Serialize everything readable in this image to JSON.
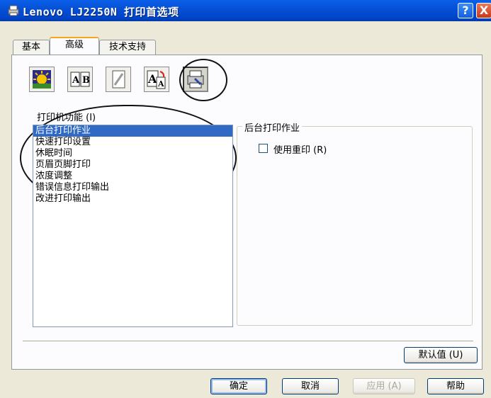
{
  "window": {
    "title": "Lenovo LJ2250N 打印首选项",
    "help_button": "?",
    "close_button": "X"
  },
  "tabs": [
    {
      "label": "基本"
    },
    {
      "label": "高级"
    },
    {
      "label": "技术支持"
    }
  ],
  "feature_buttons": [
    {
      "icon": "quality-icon"
    },
    {
      "icon": "duplex-icon"
    },
    {
      "icon": "watermark-icon"
    },
    {
      "icon": "page-setup-icon"
    },
    {
      "icon": "device-options-icon"
    }
  ],
  "features": {
    "label": "打印机功能 (I)",
    "items": [
      "后台打印作业",
      "快速打印设置",
      "休眠时间",
      "页眉页脚打印",
      "浓度调整",
      "错误信息打印输出",
      "改进打印输出"
    ],
    "selected_index": 0
  },
  "detail": {
    "group_title": "后台打印作业",
    "reprint_label": "使用重印 (R)",
    "reprint_checked": false
  },
  "buttons": {
    "default": "默认值 (U)",
    "ok": "确定",
    "cancel": "取消",
    "apply": "应用 (A)",
    "help": "帮助"
  },
  "colors": {
    "titlebar": "#0551d6",
    "selection": "#316ac5",
    "active_tab_accent": "#f5a623"
  }
}
